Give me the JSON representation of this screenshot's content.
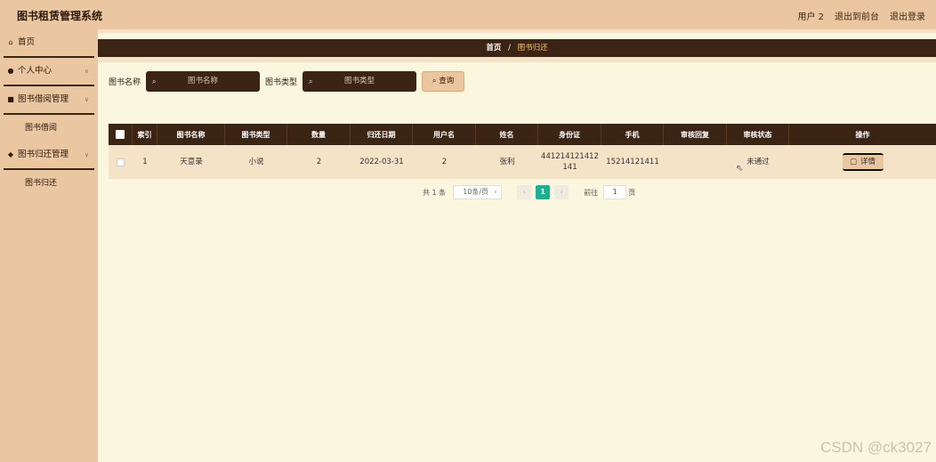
{
  "header": {
    "title": "图书租赁管理系统",
    "user_label": "用户 2",
    "back_frontend": "退出到前台",
    "logout": "退出登录"
  },
  "sidebar": {
    "home": "首页",
    "personal_center": "个人中心",
    "borrow_mgmt": "图书借阅管理",
    "borrow_sub": "图书借阅",
    "return_mgmt": "图书归还管理",
    "return_sub": "图书归还"
  },
  "breadcrumb": {
    "home": "首页",
    "separator": "/",
    "current": "图书归还"
  },
  "search": {
    "book_name_label": "图书名称",
    "book_name_placeholder": "图书名称",
    "book_type_label": "图书类型",
    "book_type_placeholder": "图书类型",
    "query_button": "查询"
  },
  "table": {
    "headers": [
      "索引",
      "图书名称",
      "图书类型",
      "数量",
      "归还日期",
      "用户名",
      "姓名",
      "身份证",
      "手机",
      "审核回复",
      "审核状态",
      "操作"
    ],
    "rows": [
      {
        "index": "1",
        "book_name": "天意录",
        "book_type": "小说",
        "quantity": "2",
        "return_date": "2022-03-31",
        "username": "2",
        "name": "张利",
        "id_card_line1": "441214121412",
        "id_card_line2": "141",
        "phone": "15214121411",
        "audit_reply": "",
        "audit_status": "未通过",
        "action": "详情"
      }
    ]
  },
  "pagination": {
    "total": "共 1 条",
    "page_size": "10条/页",
    "prev": "‹",
    "current_page": "1",
    "next": "›",
    "goto_label": "前往",
    "goto_value": "1",
    "page_unit": "页"
  },
  "watermark": "CSDN @ck3027",
  "colors": {
    "sidebar_bg": "#eac7a0",
    "dark_brown": "#3c2414",
    "content_bg": "#fbf7df",
    "pager_active": "#19b394"
  }
}
